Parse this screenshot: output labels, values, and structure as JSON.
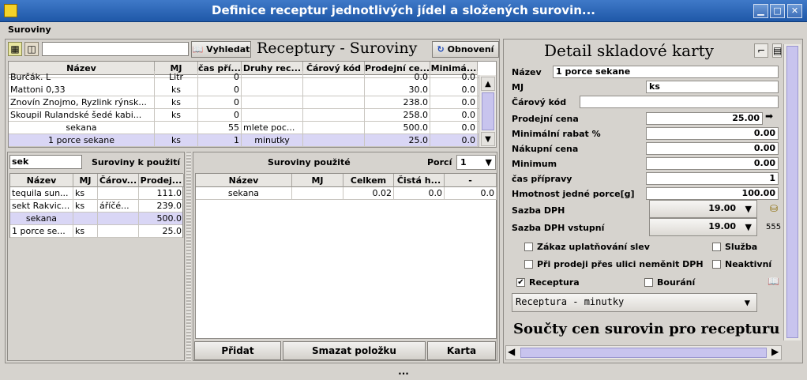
{
  "window": {
    "title": "Definice receptur jednotlivých jídel a složených surovin...",
    "min": "▁",
    "max": "□",
    "close": "✕"
  },
  "menu": {
    "item": "Suroviny"
  },
  "toolbar": {
    "search_value": "",
    "search_label": "Vyhledat",
    "heading": "Receptury - Suroviny",
    "refresh_label": "Obnovení"
  },
  "top_table": {
    "columns": [
      "Název",
      "MJ",
      "čas pří...",
      "Druhy rec...",
      "Čárový kód",
      "Prodejní ce...",
      "Minimá..."
    ],
    "rows": [
      [
        "Burčák. L",
        "Litr",
        "0",
        "",
        "",
        "0.0",
        "0.0"
      ],
      [
        "Mattoni 0,33",
        "ks",
        "0",
        "",
        "",
        "30.0",
        "0.0"
      ],
      [
        "Znovín Znojmo, Ryzlink rýnsk...",
        "ks",
        "0",
        "",
        "",
        "238.0",
        "0.0"
      ],
      [
        "Skoupil Rulandské šedé kabi...",
        "ks",
        "0",
        "",
        "",
        "258.0",
        "0.0"
      ],
      [
        "sekana",
        "",
        "55",
        "mlete poc...",
        "",
        "500.0",
        "0.0"
      ],
      [
        "1 porce sekane",
        "ks",
        "1",
        "minutky",
        "",
        "25.0",
        "0.0"
      ]
    ]
  },
  "left_panel": {
    "filter_value": "sek",
    "title": "Suroviny k použití",
    "columns": [
      "Název",
      "MJ",
      "Čárov...",
      "Prodej..."
    ],
    "rows": [
      [
        "tequila sun...",
        "ks",
        "",
        "111.0"
      ],
      [
        "sekt Rakvic...",
        "ks",
        "áříčé...",
        "239.0"
      ],
      [
        "sekana",
        "",
        "",
        "500.0"
      ],
      [
        "1 porce se...",
        "ks",
        "",
        "25.0"
      ]
    ]
  },
  "mid_panel": {
    "title": "Suroviny použité",
    "porci_label": "Porcí",
    "porci_value": "1",
    "columns": [
      "Název",
      "MJ",
      "Celkem",
      "Čistá h...",
      "-"
    ],
    "rows": [
      [
        "sekana",
        "",
        "0.02",
        "0.0",
        "0.0"
      ]
    ],
    "buttons": {
      "add": "Přidat",
      "delete": "Smazat položku",
      "card": "Karta"
    }
  },
  "detail": {
    "title": "Detail skladové karty",
    "nazev_label": "Název",
    "nazev_value": "1 porce sekane",
    "mj_label": "MJ",
    "mj_value": "ks",
    "kod_label": "Čárový kód",
    "kod_value": "",
    "fields": [
      {
        "label": "Prodejní cena",
        "value": "25.00"
      },
      {
        "label": "Minimální rabat %",
        "value": "0.00"
      },
      {
        "label": "Nákupní cena",
        "value": "0.00"
      },
      {
        "label": "Minimum",
        "value": "0.00"
      },
      {
        "label": "čas přípravy",
        "value": "1"
      },
      {
        "label": "Hmotnost jedné porce[g]",
        "value": "100.00"
      }
    ],
    "dph_label": "Sazba DPH",
    "dph_value": "19.00",
    "dph_in_label": "Sazba DPH vstupní",
    "dph_in_value": "19.00",
    "dph_in_extra": "555",
    "checks": {
      "zakaz": "Zákaz uplatňování slev",
      "sluzba": "Služba",
      "ulice": "Při prodeji přes ulici neměnit DPH",
      "neaktivni": "Neaktivní",
      "receptura": "Receptura",
      "bourani": "Bourání"
    },
    "receptura_checked": true,
    "receptura_type": "Receptura - minutky",
    "sum_title": "Součty cen surovin pro recepturu"
  },
  "status": {
    "text": "..."
  }
}
